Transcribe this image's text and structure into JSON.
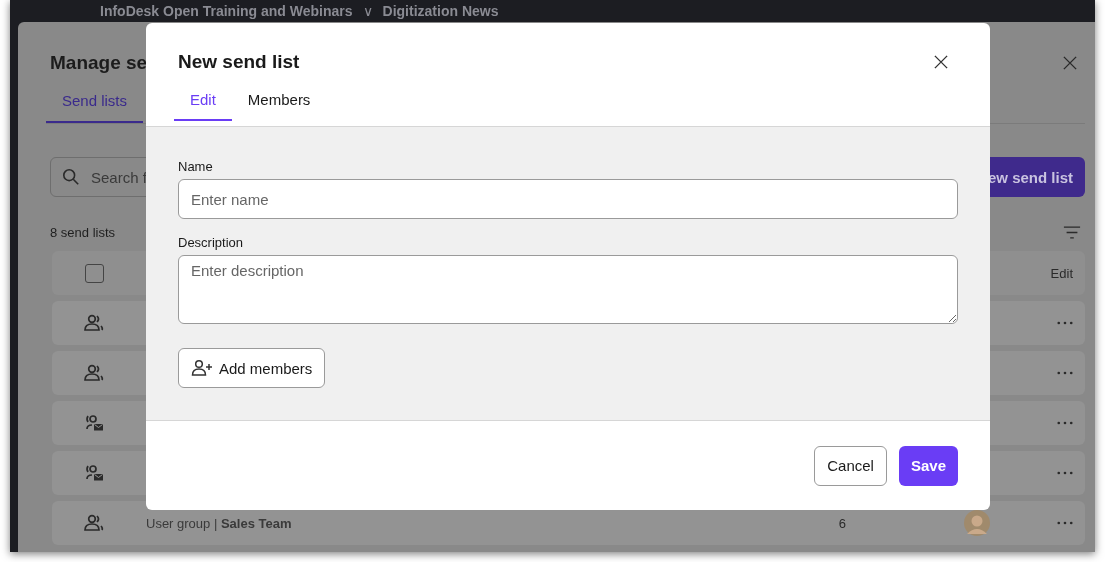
{
  "app_bar": {
    "title": "InfoDesk Open Training and Webinars",
    "caret": "∨",
    "section": "Digitization News"
  },
  "panel": {
    "title": "Manage se",
    "tabs": [
      {
        "label": "Send lists",
        "selected": true
      }
    ],
    "search": {
      "placeholder": "Search f"
    },
    "new_button": "ew send list",
    "count": "8 send lists",
    "header": {
      "checked": false,
      "edit": "Edit"
    },
    "rows": [
      {
        "kind": "group"
      },
      {
        "kind": "group"
      },
      {
        "kind": "mail-group"
      },
      {
        "kind": "mail-group"
      },
      {
        "kind": "group",
        "label": "User group | **Sales Team**",
        "members": "6",
        "avatar": true
      }
    ]
  },
  "dialog": {
    "title": "New send list",
    "tabs": [
      {
        "label": "Edit",
        "selected": true
      },
      {
        "label": "Members",
        "selected": false
      }
    ],
    "name": {
      "label": "Name",
      "placeholder": "Enter name"
    },
    "description": {
      "label": "Description",
      "placeholder": "Enter description"
    },
    "add_button": "Add members",
    "cancel": "Cancel",
    "save": "Save"
  }
}
